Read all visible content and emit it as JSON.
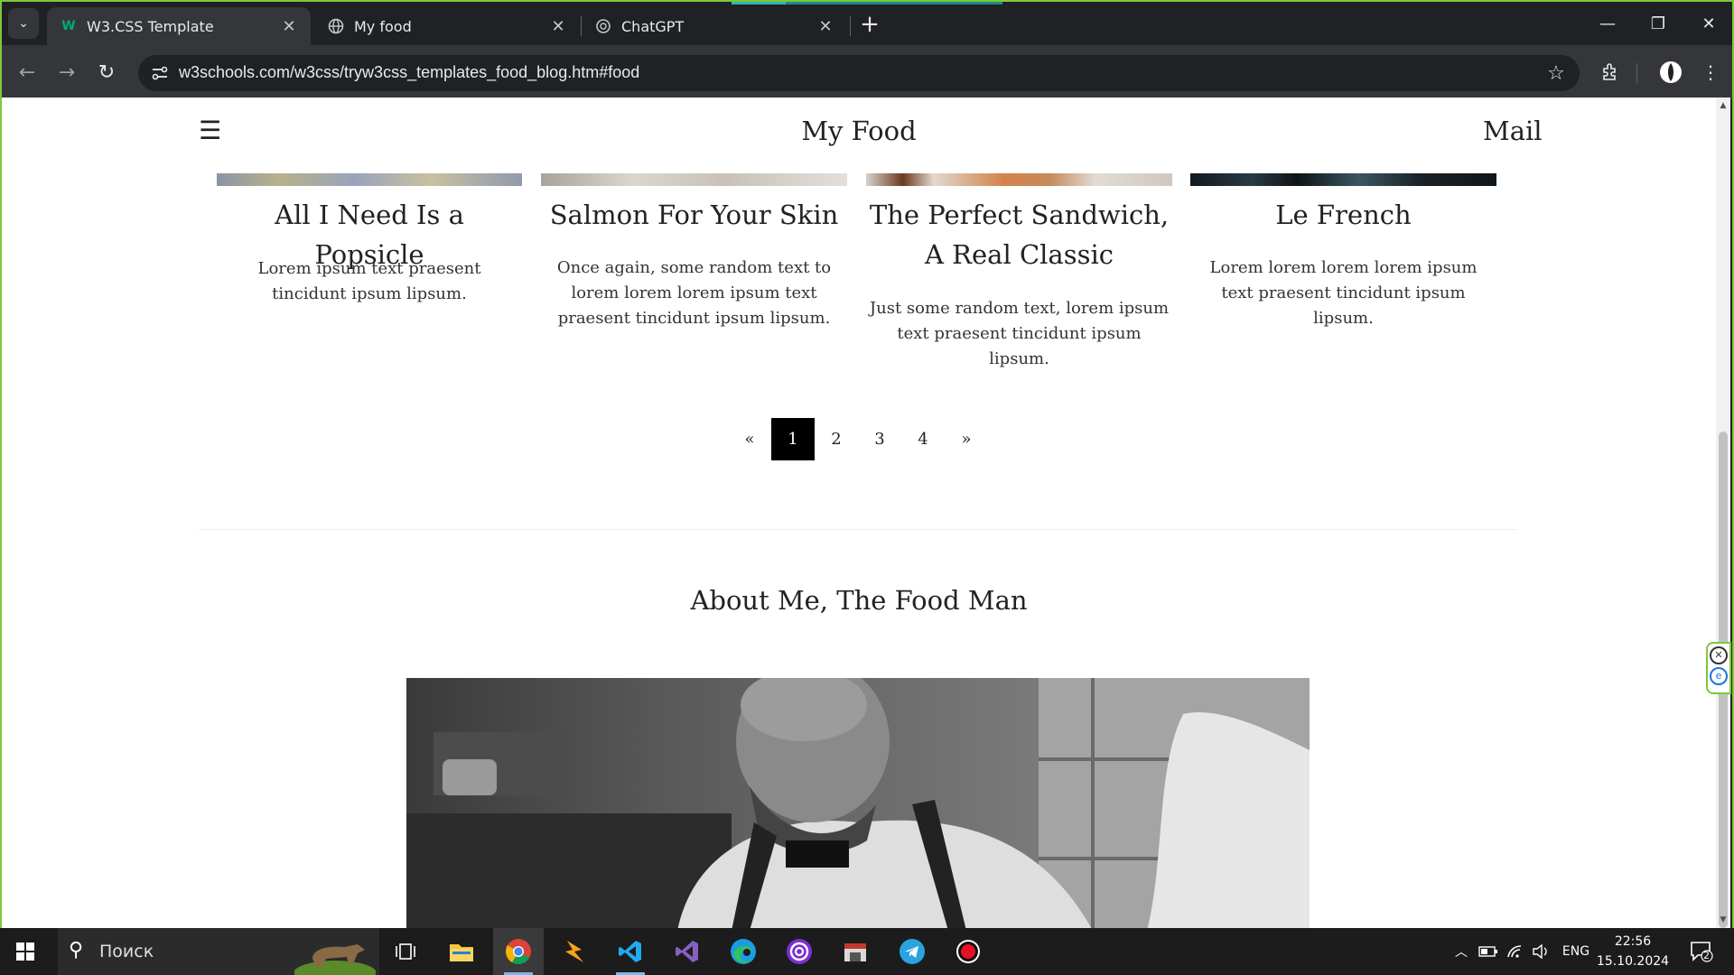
{
  "browser": {
    "tabs": [
      {
        "title": "W3.CSS Template",
        "favicon": "w3schools-icon",
        "active": true
      },
      {
        "title": "My food",
        "favicon": "globe-icon",
        "active": false
      },
      {
        "title": "ChatGPT",
        "favicon": "openai-icon",
        "active": false
      }
    ],
    "url": "w3schools.com/w3css/tryw3css_templates_food_blog.htm#food",
    "accent_color": "#7fc73d"
  },
  "page": {
    "brand": "My Food",
    "mail": "Mail",
    "cards": [
      {
        "title": "All I Need Is a Popsicle",
        "text": "Lorem ipsum text praesent tincidunt ipsum lipsum."
      },
      {
        "title": "Salmon For Your Skin",
        "text": "Once again, some random text to lorem lorem lorem ipsum text praesent tincidunt ipsum lipsum."
      },
      {
        "title": "The Perfect Sandwich, A Real Classic",
        "text": "Just some random text, lorem ipsum text praesent tincidunt ipsum lipsum."
      },
      {
        "title": "Le French",
        "text": "Lorem lorem lorem lorem ipsum text praesent tincidunt ipsum lipsum."
      }
    ],
    "pagination": {
      "prev": "«",
      "pages": [
        "1",
        "2",
        "3",
        "4"
      ],
      "next": "»",
      "current": "1"
    },
    "about_title": "About Me, The Food Man"
  },
  "taskbar": {
    "search_placeholder": "Поиск",
    "language": "ENG",
    "time": "22:56",
    "date": "15.10.2024",
    "notifications": "2"
  }
}
